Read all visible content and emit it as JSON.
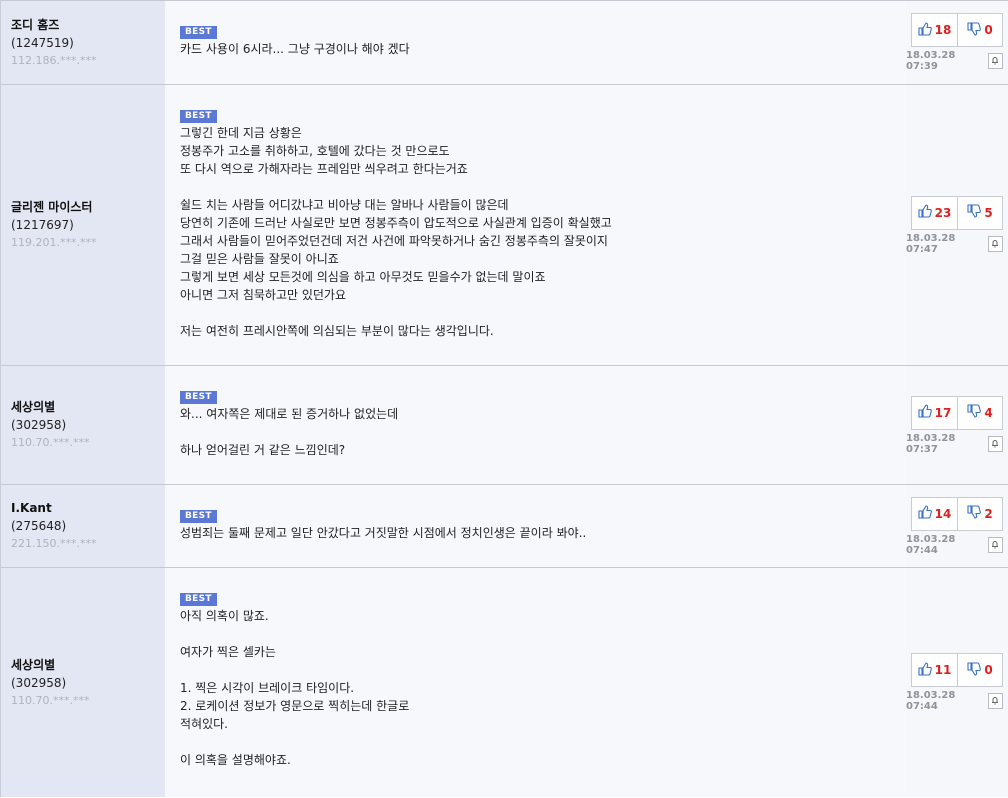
{
  "badge_label": "BEST",
  "comments": [
    {
      "nick": "조디 홈즈",
      "uid": "(1247519)",
      "ip": "112.186.***.***",
      "lines": [
        "카드 사용이 6시라... 그냥 구경이나 해야 겠다"
      ],
      "up": "18",
      "down": "0",
      "date": "18.03.28 07:39"
    },
    {
      "nick": "글리젠 마이스터",
      "uid": "(1217697)",
      "ip": "119.201.***.***",
      "lines": [
        "그렇긴 한데 지금 상황은",
        "정봉주가 고소를 취하하고, 호텔에 갔다는 것 만으로도",
        "또 다시 역으로 가해자라는 프레임만 씌우려고 한다는거죠",
        "",
        "쉴드 치는 사람들 어디갔냐고 비아냥 대는 알바나 사람들이 많은데",
        "당연히 기존에 드러난 사실로만 보면 정봉주측이 압도적으로 사실관계 입증이 확실했고",
        "그래서 사람들이 믿어주었던건데 저건 사건에 파악못하거나 숨긴 정봉주측의 잘못이지",
        "그걸 믿은 사람들 잘못이 아니죠",
        "그렇게 보면 세상 모든것에 의심을 하고 아무것도 믿을수가 없는데 말이죠",
        "아니면 그저 침묵하고만 있던가요",
        "",
        "저는 여전히 프레시안쪽에 의심되는 부분이 많다는 생각입니다."
      ],
      "up": "23",
      "down": "5",
      "date": "18.03.28 07:47"
    },
    {
      "nick": "세상의별",
      "uid": "(302958)",
      "ip": "110.70.***.***",
      "lines": [
        "와... 여자쪽은 제대로 된 증거하나 없었는데",
        "",
        "하나 얻어걸린 거 같은 느낌인데?"
      ],
      "up": "17",
      "down": "4",
      "date": "18.03.28 07:37"
    },
    {
      "nick": "I.Kant",
      "uid": "(275648)",
      "ip": "221.150.***.***",
      "lines": [
        "성범죄는 둘째 문제고 일단 안갔다고 거짓말한 시점에서 정치인생은 끝이라 봐야.."
      ],
      "up": "14",
      "down": "2",
      "date": "18.03.28 07:44"
    },
    {
      "nick": "세상의별",
      "uid": "(302958)",
      "ip": "110.70.***.***",
      "lines": [
        "아직 의혹이 많죠.",
        "",
        "여자가 찍은 셀카는",
        "",
        "1. 찍은 시각이 브레이크 타임이다.",
        "2. 로케이션 정보가 영문으로 찍히는데 한글로",
        "적혀있다.",
        "",
        "이 의혹을 설명해야죠."
      ],
      "up": "11",
      "down": "0",
      "date": "18.03.28 07:44"
    }
  ]
}
